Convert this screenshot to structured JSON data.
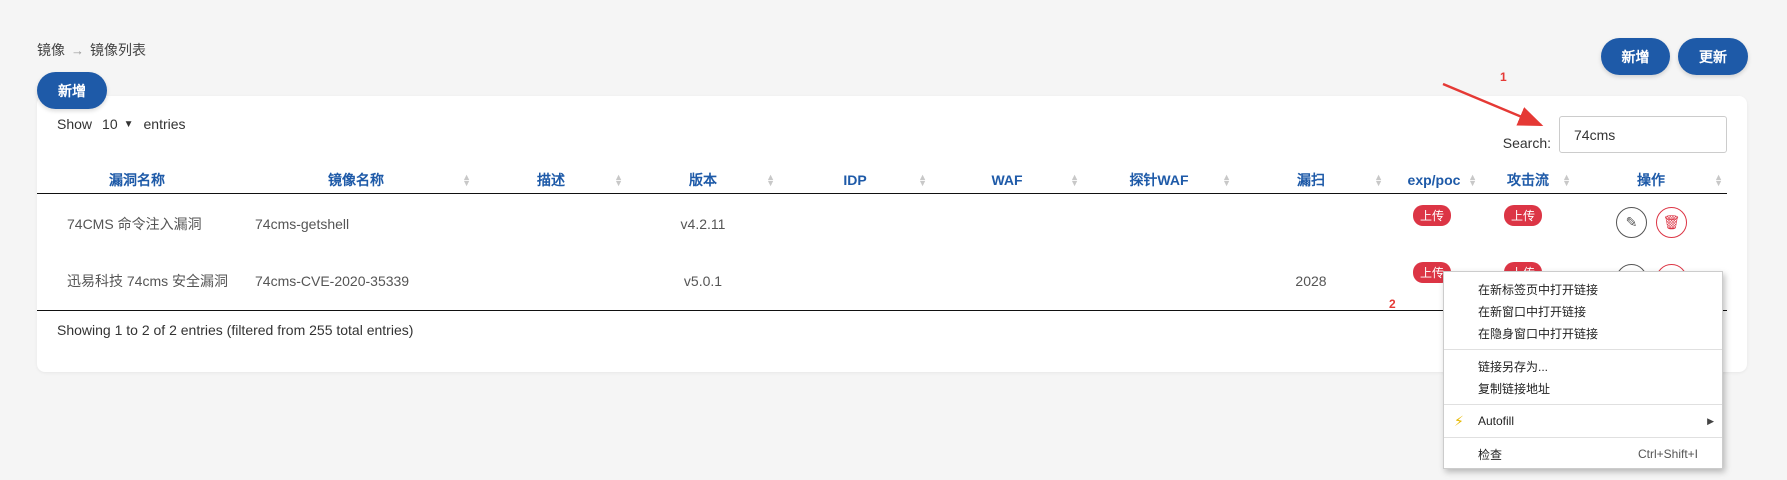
{
  "breadcrumb": {
    "root": "镜像",
    "separator": "→",
    "current": "镜像列表"
  },
  "top_buttons": {
    "add": "新增",
    "update": "更新"
  },
  "left_button": {
    "add": "新增"
  },
  "table_controls": {
    "show_label": "Show",
    "page_length": "10",
    "entries_label": "entries",
    "search_label": "Search:",
    "search_value": "74cms"
  },
  "columns": [
    "漏洞名称",
    "镜像名称",
    "描述",
    "版本",
    "IDP",
    "WAF",
    "探针WAF",
    "漏扫",
    "exp/poc",
    "攻击流",
    "操作"
  ],
  "rows": [
    {
      "vuln_name": "74CMS 命令注入漏洞",
      "image_name": "74cms-getshell",
      "desc": "",
      "version": "v4.2.11",
      "idp": "",
      "waf": "",
      "probe_waf": "",
      "scan": "",
      "exp_badge": "上传",
      "attack_badge": "上传"
    },
    {
      "vuln_name": "迅易科技 74cms 安全漏洞",
      "image_name": "74cms-CVE-2020-35339",
      "desc": "",
      "version": "v5.0.1",
      "idp": "",
      "waf": "",
      "probe_waf": "",
      "scan": "2028",
      "exp_badge": "上传",
      "attack_badge": "上传"
    }
  ],
  "table_info": "Showing 1 to 2 of 2 entries (filtered from 255 total entries)",
  "annotations": {
    "one": "1",
    "two": "2"
  },
  "context_menu": {
    "open_new_tab": "在新标签页中打开链接",
    "open_new_window": "在新窗口中打开链接",
    "open_incognito": "在隐身窗口中打开链接",
    "save_link_as": "链接另存为...",
    "copy_link": "复制链接地址",
    "autofill": "Autofill",
    "inspect": "检查",
    "inspect_shortcut": "Ctrl+Shift+I"
  },
  "colors": {
    "primary": "#1e5aa8",
    "danger": "#dc3545",
    "annotation": "#e53935"
  }
}
